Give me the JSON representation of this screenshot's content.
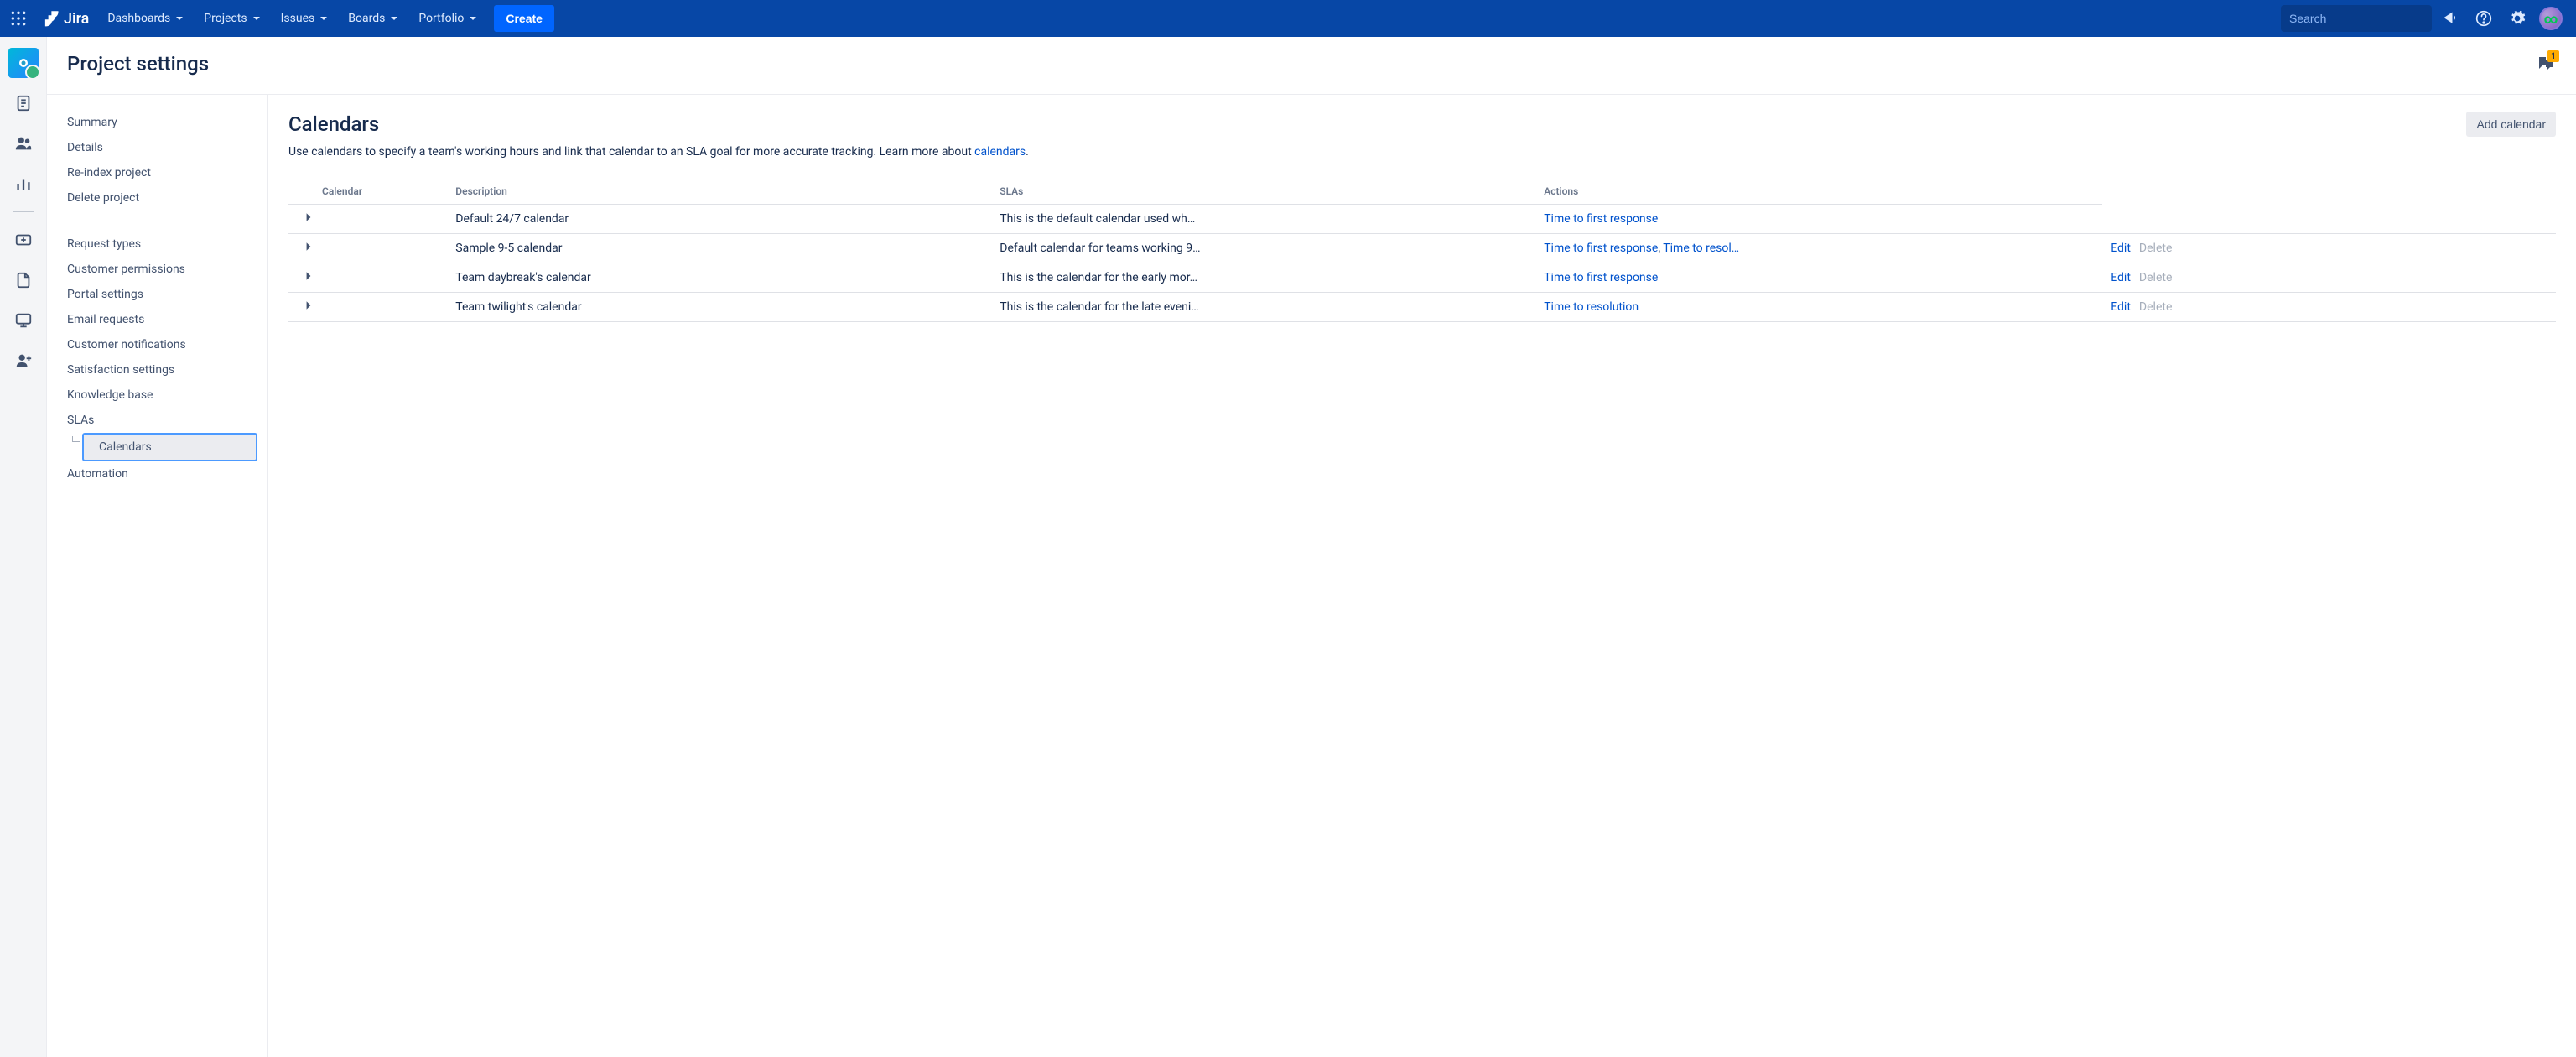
{
  "topnav": {
    "logo_text": "Jira",
    "menu": [
      "Dashboards",
      "Projects",
      "Issues",
      "Boards",
      "Portfolio"
    ],
    "create": "Create",
    "search_placeholder": "Search"
  },
  "page": {
    "title": "Project settings",
    "feedback_badge": "1"
  },
  "sidebar": {
    "group1": [
      "Summary",
      "Details",
      "Re-index project",
      "Delete project"
    ],
    "group2": [
      "Request types",
      "Customer permissions",
      "Portal settings",
      "Email requests",
      "Customer notifications",
      "Satisfaction settings",
      "Knowledge base",
      "SLAs"
    ],
    "sub_active": "Calendars",
    "group3": [
      "Automation"
    ]
  },
  "panel": {
    "title": "Calendars",
    "add_btn": "Add calendar",
    "desc_pre": "Use calendars to specify a team's working hours and link that calendar to an SLA goal for more accurate tracking. Learn more about ",
    "desc_link": "calendars",
    "desc_post": "."
  },
  "table": {
    "headers": [
      "Calendar",
      "Description",
      "SLAs",
      "Actions"
    ],
    "rows": [
      {
        "name": "Default 24/7 calendar",
        "description": "This is the default calendar used wh…",
        "slas": [
          "Time to first response"
        ],
        "edit": "",
        "delete": ""
      },
      {
        "name": "Sample 9-5 calendar",
        "description": "Default calendar for teams working 9…",
        "slas": [
          "Time to first response",
          "Time to resol…"
        ],
        "edit": "Edit",
        "delete": "Delete"
      },
      {
        "name": "Team daybreak's calendar",
        "description": "This is the calendar for the early mor…",
        "slas": [
          "Time to first response"
        ],
        "edit": "Edit",
        "delete": "Delete"
      },
      {
        "name": "Team twilight's calendar",
        "description": "This is the calendar for the late eveni…",
        "slas": [
          "Time to resolution"
        ],
        "edit": "Edit",
        "delete": "Delete"
      }
    ]
  }
}
